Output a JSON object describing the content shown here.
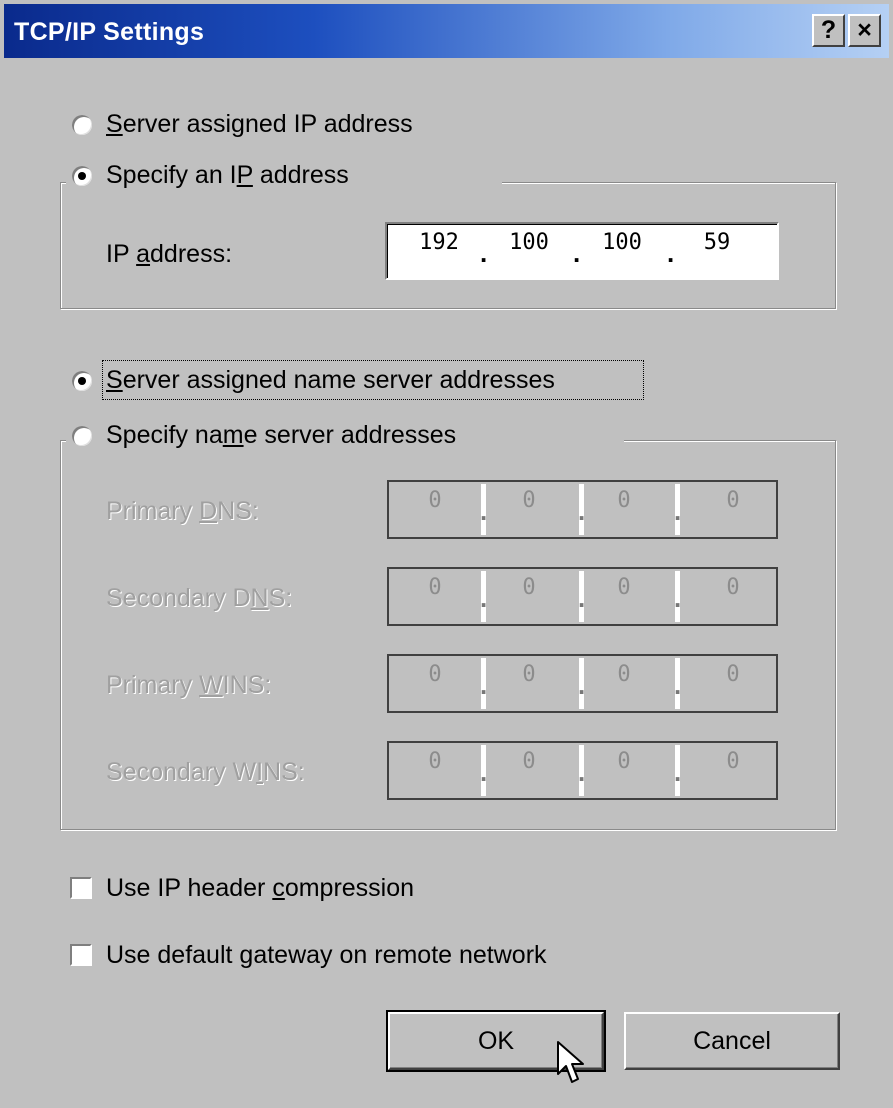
{
  "window": {
    "title": "TCP/IP Settings",
    "help_label": "?",
    "close_label": "×"
  },
  "ip_section": {
    "server_assigned_label": "Server assigned IP address",
    "specify_label": "Specify an IP address",
    "selected": "specify",
    "ip_address_label": "IP address:",
    "ip_octets": [
      "192",
      "100",
      "100",
      "59"
    ]
  },
  "dns_section": {
    "server_assigned_label": "Server assigned name server addresses",
    "specify_label": "Specify name server addresses",
    "selected": "server_assigned",
    "fields": [
      {
        "label": "Primary DNS:",
        "octets": [
          "0",
          "0",
          "0",
          "0"
        ]
      },
      {
        "label": "Secondary DNS:",
        "octets": [
          "0",
          "0",
          "0",
          "0"
        ]
      },
      {
        "label": "Primary WINS:",
        "octets": [
          "0",
          "0",
          "0",
          "0"
        ]
      },
      {
        "label": "Secondary WINS:",
        "octets": [
          "0",
          "0",
          "0",
          "0"
        ]
      }
    ]
  },
  "options": {
    "ip_header_compression": {
      "label": "Use IP header compression",
      "checked": false
    },
    "default_gateway": {
      "label": "Use default gateway on remote network",
      "checked": false
    }
  },
  "buttons": {
    "ok_label": "OK",
    "cancel_label": "Cancel"
  }
}
